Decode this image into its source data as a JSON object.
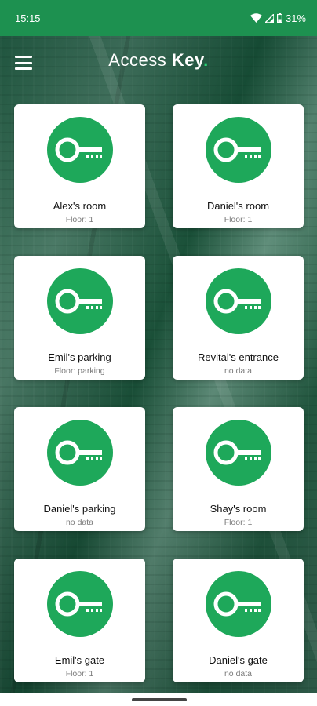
{
  "status_bar": {
    "time": "15:15",
    "battery": "31%"
  },
  "header": {
    "title_light": "Access ",
    "title_bold": "Key",
    "title_dot": ".",
    "menu_icon": "hamburger-menu-icon"
  },
  "colors": {
    "status_bar": "#1d9150",
    "key_circle": "#1ea85a",
    "accent_dot": "#2bd375"
  },
  "keys": [
    {
      "name": "Alex's room",
      "floor": "Floor: 1",
      "icon": "key-icon"
    },
    {
      "name": "Daniel's room",
      "floor": "Floor: 1",
      "icon": "key-icon"
    },
    {
      "name": "Emil's parking",
      "floor": "Floor: parking",
      "icon": "key-icon"
    },
    {
      "name": "Revital's entrance",
      "floor": "no data",
      "icon": "key-icon"
    },
    {
      "name": "Daniel's parking",
      "floor": "no data",
      "icon": "key-icon"
    },
    {
      "name": "Shay's room",
      "floor": "Floor: 1",
      "icon": "key-icon"
    },
    {
      "name": "Emil's gate",
      "floor": "Floor: 1",
      "icon": "key-icon"
    },
    {
      "name": "Daniel's gate",
      "floor": "no data",
      "icon": "key-icon"
    }
  ]
}
